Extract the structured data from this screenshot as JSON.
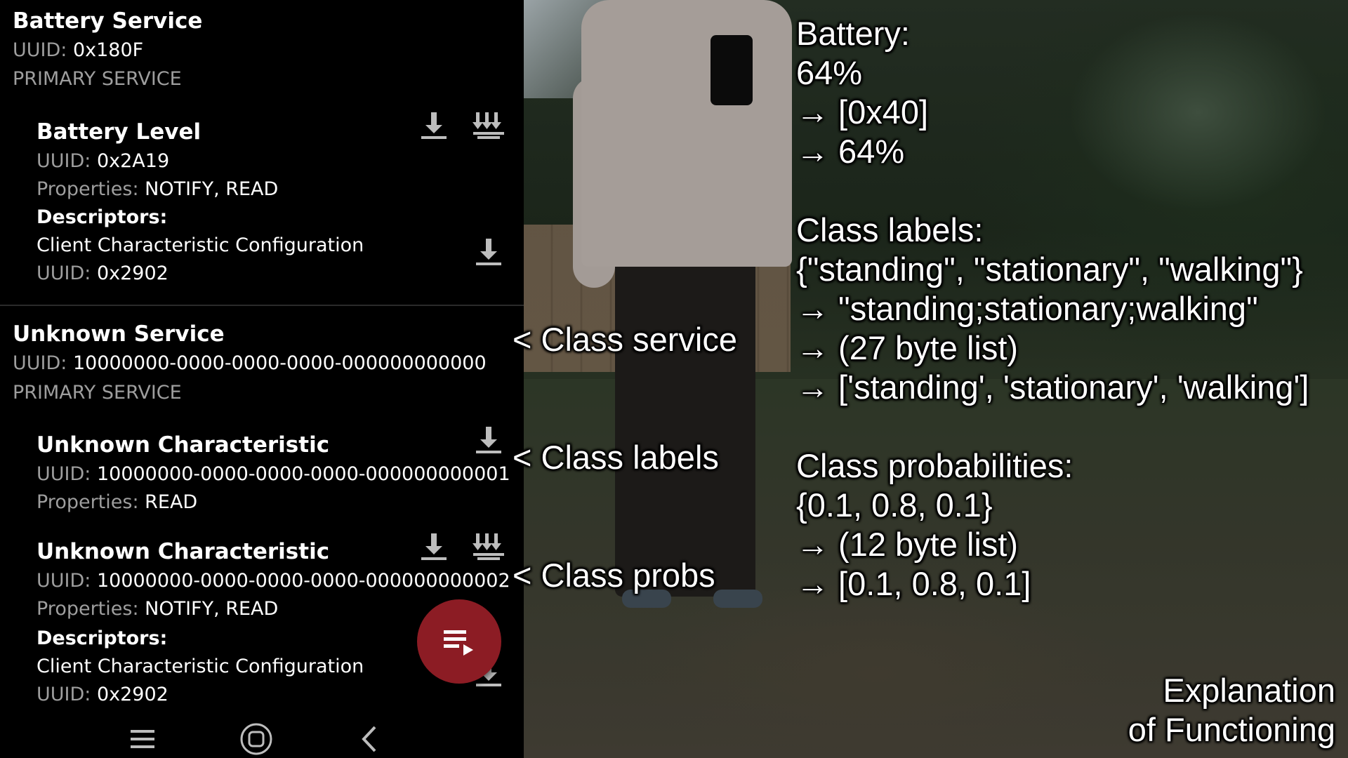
{
  "services": [
    {
      "title": "Battery Service",
      "uuid_label": "UUID:",
      "uuid": "0x180F",
      "type": "PRIMARY SERVICE",
      "characteristics": [
        {
          "title": "Battery Level",
          "uuid_label": "UUID:",
          "uuid": "0x2A19",
          "properties_label": "Properties:",
          "properties": "NOTIFY, READ",
          "descriptors_label": "Descriptors:",
          "descriptor_name": "Client Characteristic Configuration",
          "descriptor_uuid_label": "UUID:",
          "descriptor_uuid": "0x2902"
        }
      ]
    },
    {
      "title": "Unknown Service",
      "uuid_label": "UUID:",
      "uuid": "10000000-0000-0000-0000-000000000000",
      "type": "PRIMARY SERVICE",
      "characteristics": [
        {
          "title": "Unknown Characteristic",
          "uuid_label": "UUID:",
          "uuid": "10000000-0000-0000-0000-000000000001",
          "properties_label": "Properties:",
          "properties": "READ"
        },
        {
          "title": "Unknown Characteristic",
          "uuid_label": "UUID:",
          "uuid": "10000000-0000-0000-0000-000000000002",
          "properties_label": "Properties:",
          "properties": "NOTIFY, READ",
          "descriptors_label": "Descriptors:",
          "descriptor_name": "Client Characteristic Configuration",
          "descriptor_uuid_label": "UUID:",
          "descriptor_uuid": "0x2902"
        }
      ]
    }
  ],
  "icons": {
    "read": "download-icon",
    "notify": "notify-multiple-download-icon",
    "fab": "log-list-icon",
    "nav_recents": "recents-icon",
    "nav_home": "home-icon",
    "nav_back": "back-icon"
  },
  "colors": {
    "fab": "#8c1c24",
    "label_gray": "#9e9e9e",
    "background": "#000000"
  },
  "overlay": {
    "arrows": {
      "class_service": "< Class service",
      "class_labels": "< Class labels",
      "class_probs": "< Class probs"
    },
    "battery": {
      "title": "Battery:",
      "value": "64%",
      "raw": "→ [0x40]",
      "decoded": "→ 64%"
    },
    "labels": {
      "title": "Class labels:",
      "set": "{\"standing\", \"stationary\", \"walking\"}",
      "joined": "→ \"standing;stationary;walking\"",
      "bytes": "→ (27 byte list)",
      "decoded": "→ ['standing', 'stationary', 'walking']"
    },
    "probs": {
      "title": "Class probabilities:",
      "set": "{0.1, 0.8, 0.1}",
      "bytes": "→ (12 byte list)",
      "decoded": "→ [0.1, 0.8, 0.1]"
    },
    "caption": {
      "line1": "Explanation",
      "line2": "of Functioning"
    }
  }
}
